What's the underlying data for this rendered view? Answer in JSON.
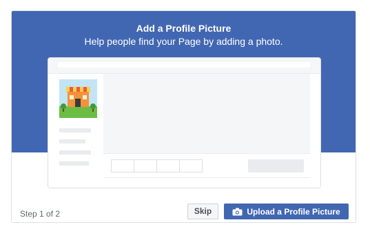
{
  "dialog": {
    "title": "Add a Profile Picture",
    "subtitle": "Help people find your Page by adding a photo."
  },
  "footer": {
    "step_label": "Step 1 of 2",
    "skip_label": "Skip",
    "upload_label": "Upload a Profile Picture",
    "upload_icon": "camera-icon"
  },
  "colors": {
    "brand_blue": "#4267b2",
    "placeholder_gray": "#e9ebee",
    "panel_bg": "#f5f6f7"
  }
}
